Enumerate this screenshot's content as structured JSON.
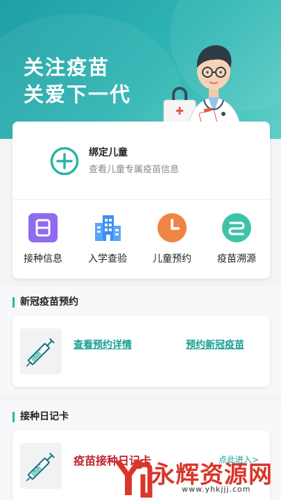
{
  "hero": {
    "title_line1": "关注疫苗",
    "title_line2": "关爱下一代"
  },
  "bind_child": {
    "icon": "plus-circle-icon",
    "title": "绑定儿童",
    "subtitle": "查看儿童专属疫苗信息"
  },
  "features": [
    {
      "label": "接种信息",
      "icon": "record-icon",
      "color": "#8f6bf0"
    },
    {
      "label": "入学查验",
      "icon": "building-icon",
      "color": "#3d8ff5"
    },
    {
      "label": "儿童预约",
      "icon": "clock-icon",
      "color": "#f08444"
    },
    {
      "label": "疫苗溯源",
      "icon": "trace-icon",
      "color": "#3ec3a8"
    }
  ],
  "covid_section": {
    "title": "新冠疫苗预约",
    "view_details": "查看预约详情",
    "book": "预约新冠疫苗"
  },
  "diary_section": {
    "title": "接种日记卡",
    "card_title": "疫苗接种日记卡",
    "enter": "点此进入>"
  },
  "watermark": {
    "text": "永辉资源网",
    "url": "www.yhkjjj.com"
  },
  "colors": {
    "accent": "#2bb3a5",
    "hero_start": "#1f9fa6",
    "hero_end": "#5fd0c6",
    "diary_title": "#c2222c"
  }
}
